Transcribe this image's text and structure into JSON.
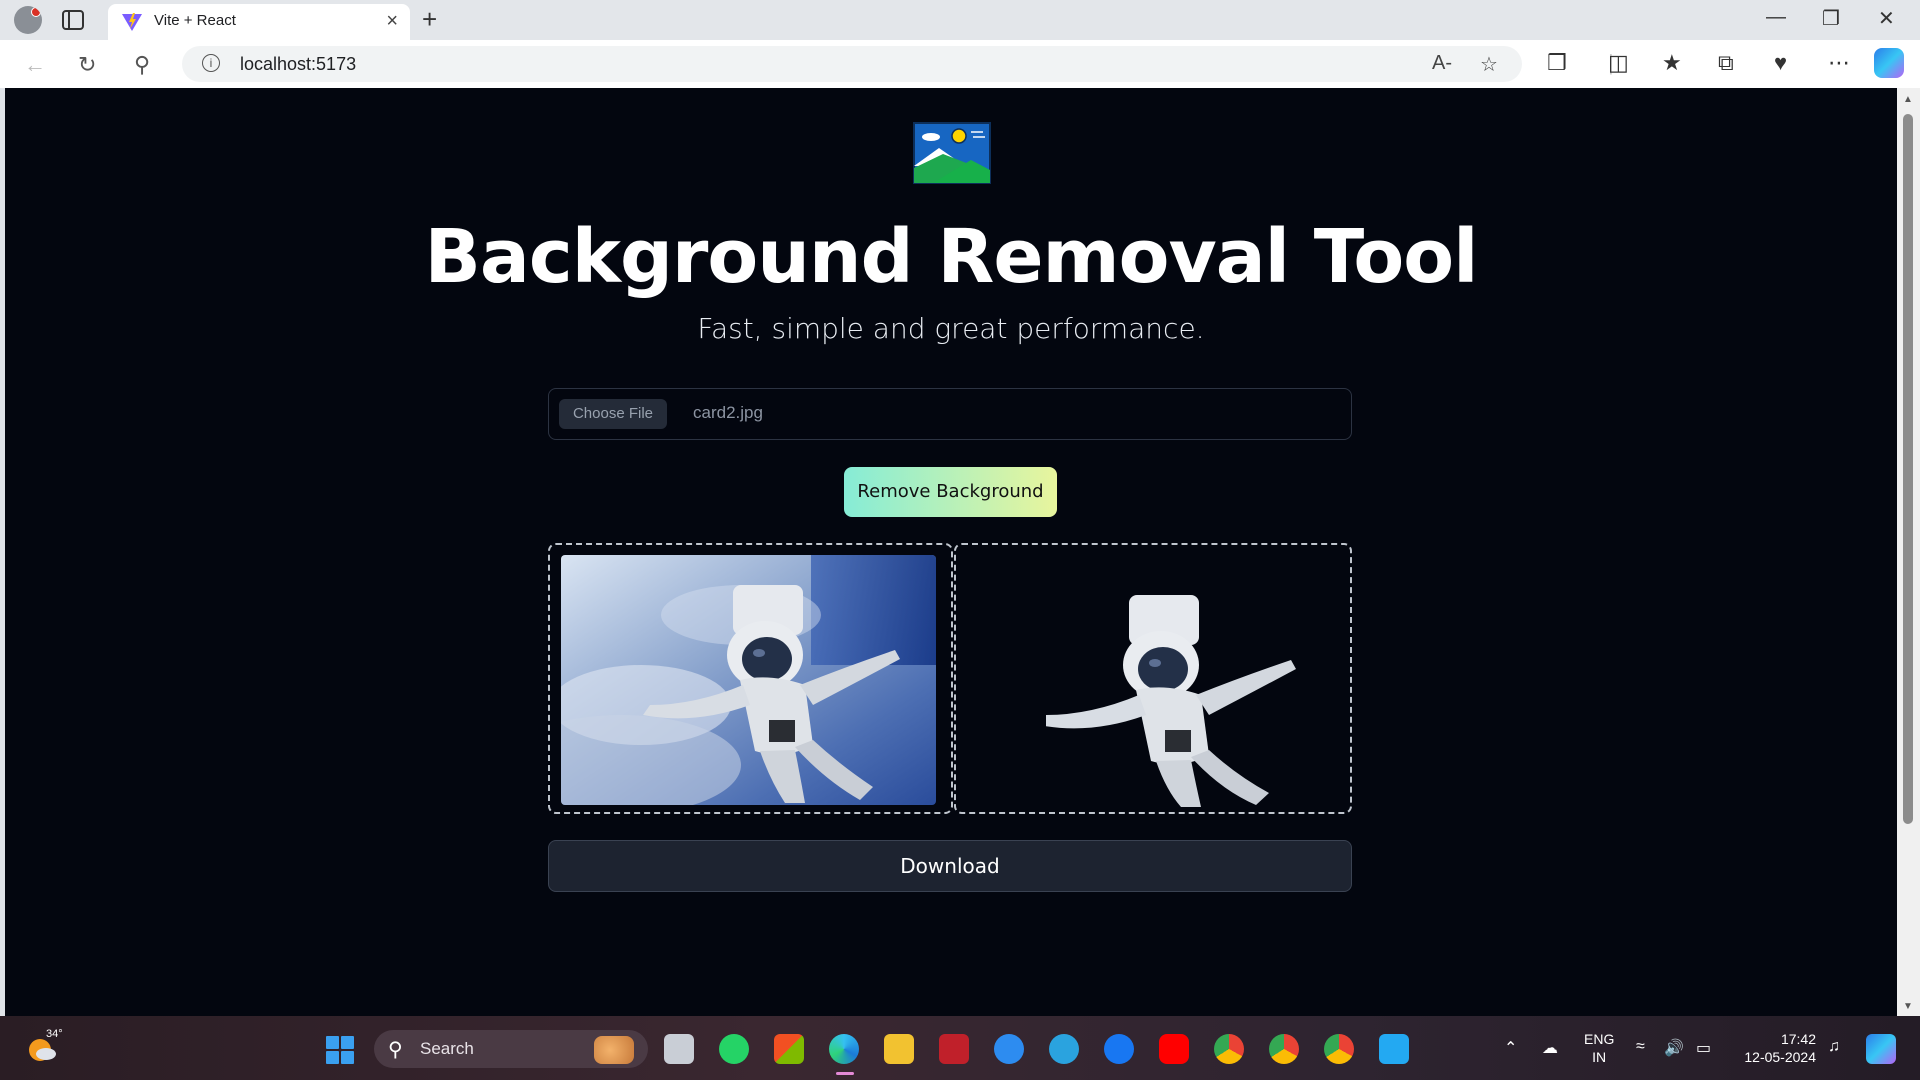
{
  "browser": {
    "tab_title": "Vite + React",
    "url": "localhost:5173",
    "new_tab_glyph": "+",
    "close_glyph": "×"
  },
  "app": {
    "heading": "Background Removal Tool",
    "subheading": "Fast, simple and great performance.",
    "choose_file_label": "Choose File",
    "file_name": "card2.jpg",
    "remove_button_label": "Remove Background",
    "download_button_label": "Download"
  },
  "taskbar": {
    "weather_temp": "34°",
    "search_label": "Search",
    "language_line1": "ENG",
    "language_line2": "IN",
    "time": "17:42",
    "date": "12-05-2024"
  },
  "colors": {
    "page_bg": "#03060f",
    "button_gradient_start": "#86ecd6",
    "button_gradient_end": "#e8f59d",
    "download_bg": "#1d2330"
  }
}
